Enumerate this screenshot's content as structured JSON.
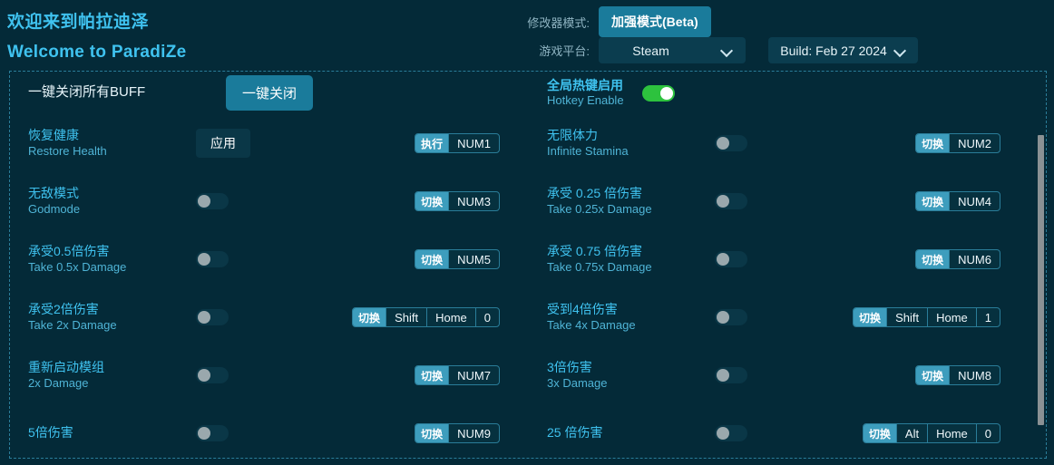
{
  "header": {
    "title_zh": "欢迎来到帕拉迪泽",
    "title_en": "Welcome to ParadiZe",
    "mode_label": "修改器模式:",
    "mode_value": "加强模式(Beta)",
    "platform_label": "游戏平台:",
    "platform_value": "Steam",
    "build_value": "Build: Feb 27 2024",
    "chevron_icon": "chevron-down-icon"
  },
  "colors": {
    "background": "#042a38",
    "accent_teal": "#1a7b9b",
    "accent_cyan": "#3fc2ef",
    "chip_action": "#3d9dbd",
    "toggle_on": "#2dc23e",
    "toggle_off_knob": "#9aa8ad",
    "panel_border": "#2a7d99",
    "scrollbar": "#8a9194"
  },
  "top_row": {
    "left": {
      "label": "一键关闭所有BUFF",
      "button": "一键关闭"
    },
    "right": {
      "label_zh": "全局热键启用",
      "label_en": "Hotkey Enable",
      "toggle_state": "on"
    }
  },
  "rows": [
    {
      "left": {
        "zh": "恢复健康",
        "en": "Restore Health",
        "control": "button",
        "button_label": "应用",
        "hotkey": {
          "action": "执行",
          "keys": [
            "NUM1"
          ]
        }
      },
      "right": {
        "zh": "无限体力",
        "en": "Infinite Stamina",
        "control": "toggle",
        "toggle_state": "off",
        "hotkey": {
          "action": "切换",
          "keys": [
            "NUM2"
          ]
        }
      }
    },
    {
      "left": {
        "zh": "无敌模式",
        "en": "Godmode",
        "control": "toggle",
        "toggle_state": "off",
        "hotkey": {
          "action": "切换",
          "keys": [
            "NUM3"
          ]
        }
      },
      "right": {
        "zh": "承受 0.25 倍伤害",
        "en": "Take 0.25x Damage",
        "control": "toggle",
        "toggle_state": "off",
        "hotkey": {
          "action": "切换",
          "keys": [
            "NUM4"
          ]
        }
      }
    },
    {
      "left": {
        "zh": "承受0.5倍伤害",
        "en": "Take 0.5x Damage",
        "control": "toggle",
        "toggle_state": "off",
        "hotkey": {
          "action": "切换",
          "keys": [
            "NUM5"
          ]
        }
      },
      "right": {
        "zh": "承受 0.75 倍伤害",
        "en": "Take 0.75x Damage",
        "control": "toggle",
        "toggle_state": "off",
        "hotkey": {
          "action": "切换",
          "keys": [
            "NUM6"
          ]
        }
      }
    },
    {
      "left": {
        "zh": "承受2倍伤害",
        "en": "Take 2x Damage",
        "control": "toggle",
        "toggle_state": "off",
        "hotkey": {
          "action": "切换",
          "keys": [
            "Shift",
            "Home",
            "0"
          ]
        }
      },
      "right": {
        "zh": "受到4倍伤害",
        "en": "Take 4x Damage",
        "control": "toggle",
        "toggle_state": "off",
        "hotkey": {
          "action": "切换",
          "keys": [
            "Shift",
            "Home",
            "1"
          ]
        }
      }
    },
    {
      "left": {
        "zh": "重新启动模组",
        "en": "2x Damage",
        "control": "toggle",
        "toggle_state": "off",
        "hotkey": {
          "action": "切换",
          "keys": [
            "NUM7"
          ]
        }
      },
      "right": {
        "zh": "3倍伤害",
        "en": "3x Damage",
        "control": "toggle",
        "toggle_state": "off",
        "hotkey": {
          "action": "切换",
          "keys": [
            "NUM8"
          ]
        }
      }
    },
    {
      "left": {
        "zh": "5倍伤害",
        "en": "",
        "control": "toggle",
        "toggle_state": "off",
        "hotkey": {
          "action": "切换",
          "keys": [
            "NUM9"
          ]
        }
      },
      "right": {
        "zh": "25 倍伤害",
        "en": "",
        "control": "toggle",
        "toggle_state": "off",
        "hotkey": {
          "action": "切换",
          "keys": [
            "Alt",
            "Home",
            "0"
          ]
        }
      }
    }
  ]
}
